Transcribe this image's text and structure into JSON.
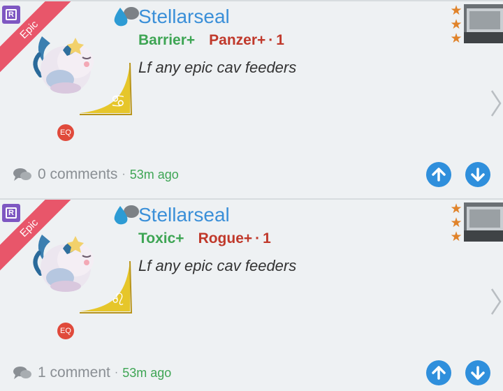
{
  "posts": [
    {
      "ribbon": "Epic",
      "rarity_badge": "R",
      "username": "Stellarseal",
      "tag_a": "Barrier+",
      "tag_b": "Panzer+",
      "tag_count": "1",
      "message": "Lf any epic cav feeders",
      "zodiac_symbol": "♋",
      "eq_badge": "EQ",
      "comments": "0 comments",
      "time": "53m ago"
    },
    {
      "ribbon": "Epic",
      "rarity_badge": "R",
      "username": "Stellarseal",
      "tag_a": "Toxic+",
      "tag_b": "Rogue+",
      "tag_count": "1",
      "message": "Lf any epic cav feeders",
      "zodiac_symbol": "♌",
      "eq_badge": "EQ",
      "comments": "1 comment",
      "time": "53m ago"
    }
  ],
  "icons": {
    "element": "water-drop-and-rock-icon",
    "stars": "star-icon",
    "comment": "speech-bubbles-icon",
    "upvote": "arrow-up-icon",
    "downvote": "arrow-down-icon",
    "next": "chevron-right-icon"
  },
  "colors": {
    "ribbon": "#e8566a",
    "username": "#3a8fd8",
    "tag_green": "#3ea554",
    "tag_red": "#c0392b",
    "vote_button": "#2f8fdc",
    "star": "#e0832a"
  }
}
